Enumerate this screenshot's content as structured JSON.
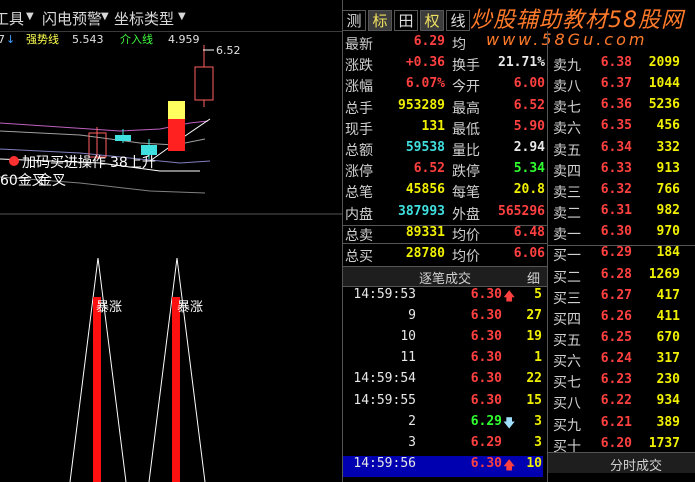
{
  "toolbar": {
    "item1": "工具",
    "item2": "闪电预警",
    "item3": "坐标类型"
  },
  "chart_header": {
    "line1_label": "强势线",
    "line1_value": "5.543",
    "line2_label": "介入线",
    "line2_value": "4.959",
    "high_label": "6.52"
  },
  "chart_overlay": {
    "text1": "加码买进操作",
    "text2": "38上升",
    "text3": "60金叉",
    "text4": "金叉"
  },
  "signals": {
    "label1": "暴涨",
    "label2": "暴涨"
  },
  "tabs": [
    "测",
    "标",
    "田",
    "权",
    "线"
  ],
  "watermark": {
    "line1": "炒股辅助教材58股网",
    "line2": "www.58Gu.com"
  },
  "quote": {
    "rows": [
      {
        "l1": "最新",
        "v1": "6.29",
        "c1": "red",
        "l2": "均",
        "v2": "",
        "c2": "white"
      },
      {
        "l1": "涨跌",
        "v1": "+0.36",
        "c1": "red",
        "l2": "换手",
        "v2": "21.71%",
        "c2": "white"
      },
      {
        "l1": "涨幅",
        "v1": "6.07%",
        "c1": "red",
        "l2": "今开",
        "v2": "6.00",
        "c2": "red"
      },
      {
        "l1": "总手",
        "v1": "953289",
        "c1": "yellow",
        "l2": "最高",
        "v2": "6.52",
        "c2": "red"
      },
      {
        "l1": "现手",
        "v1": "131",
        "c1": "yellow",
        "l2": "最低",
        "v2": "5.90",
        "c2": "red"
      },
      {
        "l1": "总额",
        "v1": "59538",
        "c1": "cyan",
        "l2": "量比",
        "v2": "2.94",
        "c2": "white"
      },
      {
        "l1": "涨停",
        "v1": "6.52",
        "c1": "red",
        "l2": "跌停",
        "v2": "5.34",
        "c2": "green"
      },
      {
        "l1": "总笔",
        "v1": "45856",
        "c1": "yellow",
        "l2": "每笔",
        "v2": "20.8",
        "c2": "yellow"
      },
      {
        "l1": "内盘",
        "v1": "387993",
        "c1": "cyan",
        "l2": "外盘",
        "v2": "565296",
        "c2": "red"
      },
      {
        "l1": "总卖",
        "v1": "89331",
        "c1": "yellow",
        "l2": "均价",
        "v2": "6.48",
        "c2": "red"
      },
      {
        "l1": "总买",
        "v1": "28780",
        "c1": "yellow",
        "l2": "均价",
        "v2": "6.06",
        "c2": "red"
      }
    ]
  },
  "orderbook": {
    "sell": [
      {
        "label": "卖九",
        "price": "6.38",
        "vol": "2099"
      },
      {
        "label": "卖八",
        "price": "6.37",
        "vol": "1044"
      },
      {
        "label": "卖七",
        "price": "6.36",
        "vol": "5236"
      },
      {
        "label": "卖六",
        "price": "6.35",
        "vol": "456"
      },
      {
        "label": "卖五",
        "price": "6.34",
        "vol": "332"
      },
      {
        "label": "卖四",
        "price": "6.33",
        "vol": "913"
      },
      {
        "label": "卖三",
        "price": "6.32",
        "vol": "766"
      },
      {
        "label": "卖二",
        "price": "6.31",
        "vol": "982"
      },
      {
        "label": "卖一",
        "price": "6.30",
        "vol": "970"
      }
    ],
    "buy": [
      {
        "label": "买一",
        "price": "6.29",
        "vol": "184"
      },
      {
        "label": "买二",
        "price": "6.28",
        "vol": "1269"
      },
      {
        "label": "买三",
        "price": "6.27",
        "vol": "417"
      },
      {
        "label": "买四",
        "price": "6.26",
        "vol": "411"
      },
      {
        "label": "买五",
        "price": "6.25",
        "vol": "670"
      },
      {
        "label": "买六",
        "price": "6.24",
        "vol": "317"
      },
      {
        "label": "买七",
        "price": "6.23",
        "vol": "230"
      },
      {
        "label": "买八",
        "price": "6.22",
        "vol": "934"
      },
      {
        "label": "买九",
        "price": "6.21",
        "vol": "389"
      },
      {
        "label": "买十",
        "price": "6.20",
        "vol": "1737"
      }
    ],
    "footer_tab": "分时成交"
  },
  "ticks": {
    "header": "逐笔成交",
    "header_btn": "细",
    "rows": [
      {
        "time": "14:59:53",
        "price": "6.30",
        "arrow": "up",
        "vol": "5"
      },
      {
        "time": "9",
        "price": "6.30",
        "arrow": "",
        "vol": "27"
      },
      {
        "time": "10",
        "price": "6.30",
        "arrow": "",
        "vol": "19"
      },
      {
        "time": "11",
        "price": "6.30",
        "arrow": "",
        "vol": "1"
      },
      {
        "time": "14:59:54",
        "price": "6.30",
        "arrow": "",
        "vol": "22"
      },
      {
        "time": "14:59:55",
        "price": "6.30",
        "arrow": "",
        "vol": "15"
      },
      {
        "time": "2",
        "price": "6.29",
        "arrow": "down",
        "vol": "3"
      },
      {
        "time": "3",
        "price": "6.29",
        "arrow": "",
        "vol": "3"
      },
      {
        "time": "14:59:56",
        "price": "6.30",
        "arrow": "up",
        "vol": "10"
      }
    ]
  },
  "colors": {
    "up": "#ff4040",
    "down": "#30ff30",
    "volume": "#f0f000",
    "accent_blue": "#0000b0"
  }
}
